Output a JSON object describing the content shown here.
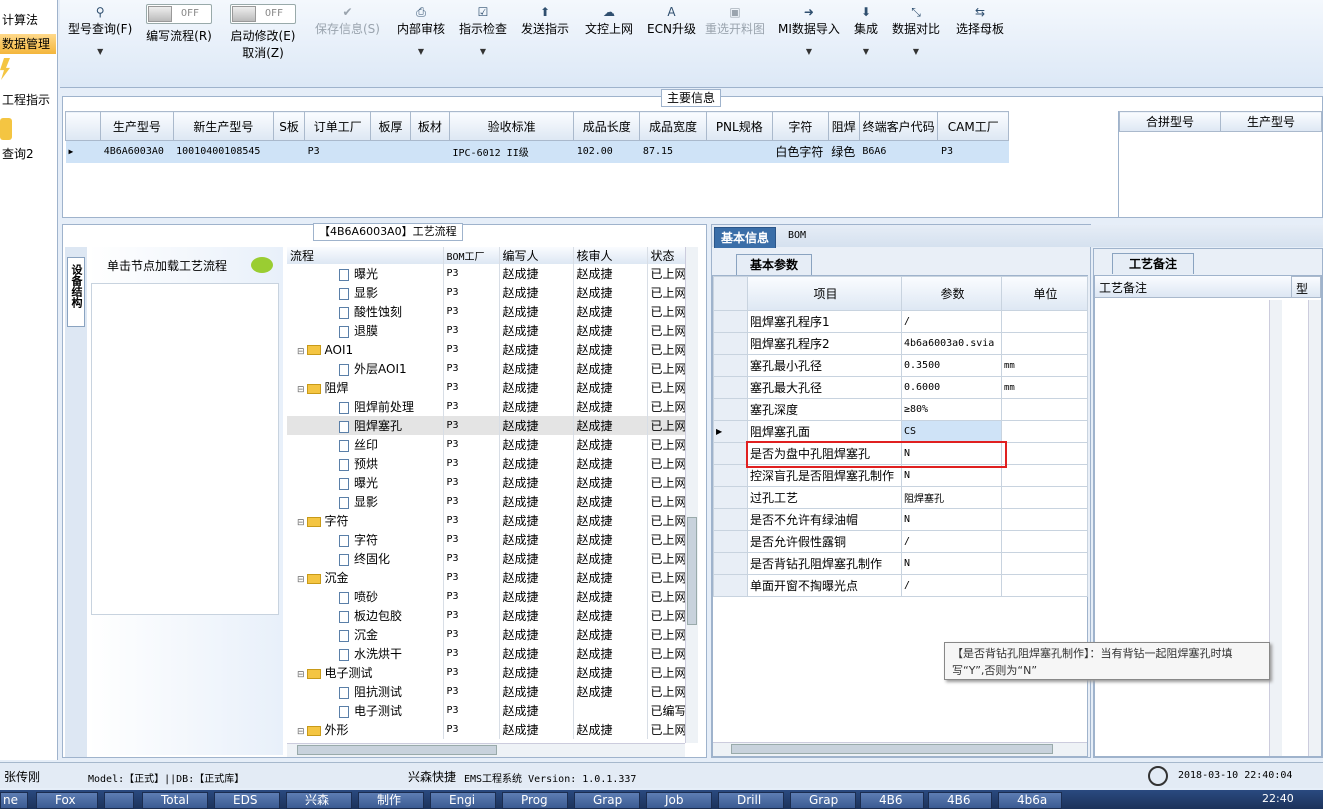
{
  "leftnav": {
    "items": [
      "计算法",
      "数据管理",
      "工程指示",
      "查询2"
    ]
  },
  "toolbar": {
    "buttons": [
      {
        "label": "型号查询(F)",
        "icon": "search-icon"
      },
      {
        "label": "编写流程(R)",
        "toggle": "OFF"
      },
      {
        "label": "启动修改(E)",
        "label2": "取消(Z)",
        "toggle": "OFF"
      },
      {
        "label": "保存信息(S)",
        "icon": "check-icon",
        "disabled": true
      },
      {
        "label": "内部审核",
        "icon": "print-icon"
      },
      {
        "label": "指示检查",
        "icon": "checkbox-icon"
      },
      {
        "label": "发送指示",
        "icon": "upload-icon"
      },
      {
        "label": "文控上网",
        "icon": "cloud-upload-icon"
      },
      {
        "label": "ECN升级",
        "icon": "font-icon"
      },
      {
        "label": "重选开料图",
        "icon": "image-icon",
        "disabled": true
      },
      {
        "label": "MI数据导入",
        "icon": "sign-in-icon"
      },
      {
        "label": "集成",
        "icon": "download-icon"
      },
      {
        "label": "数据对比",
        "icon": "compress-icon"
      },
      {
        "label": "选择母板",
        "icon": "shuffle-icon"
      }
    ]
  },
  "maininfo": {
    "title": "主要信息",
    "columns": [
      "生产型号",
      "新生产型号",
      "S板",
      "订单工厂",
      "板厚",
      "板材",
      "验收标准",
      "成品长度",
      "成品宽度",
      "PNL规格",
      "字符",
      "阻焊",
      "终端客户代码",
      "CAM工厂"
    ],
    "row": [
      "4B6A6003A0",
      "10010400108545",
      "",
      "P3",
      "",
      "",
      "IPC-6012 II级",
      "102.00",
      "87.15",
      "",
      "白色字符",
      "绿色",
      "B6A6",
      "P3"
    ],
    "merge_columns": [
      "合拼型号",
      "生产型号"
    ]
  },
  "flow": {
    "title": "【4B6A6003A0】工艺流程",
    "vtab": "设备结构",
    "hint": "单击节点加载工艺流程",
    "columns": [
      "流程",
      "BOM工厂",
      "编写人",
      "核审人",
      "状态"
    ],
    "rows": [
      {
        "name": "曝光",
        "level": 2,
        "bom": "P3",
        "writer": "赵成捷",
        "reviewer": "赵成捷",
        "status": "已上网"
      },
      {
        "name": "显影",
        "level": 2,
        "bom": "P3",
        "writer": "赵成捷",
        "reviewer": "赵成捷",
        "status": "已上网"
      },
      {
        "name": "酸性蚀刻",
        "level": 2,
        "bom": "P3",
        "writer": "赵成捷",
        "reviewer": "赵成捷",
        "status": "已上网"
      },
      {
        "name": "退膜",
        "level": 2,
        "bom": "P3",
        "writer": "赵成捷",
        "reviewer": "赵成捷",
        "status": "已上网"
      },
      {
        "name": "AOI1",
        "level": 1,
        "bom": "P3",
        "writer": "赵成捷",
        "reviewer": "赵成捷",
        "status": "已上网"
      },
      {
        "name": "外层AOI1",
        "level": 2,
        "bom": "P3",
        "writer": "赵成捷",
        "reviewer": "赵成捷",
        "status": "已上网"
      },
      {
        "name": "阻焊",
        "level": 1,
        "bom": "P3",
        "writer": "赵成捷",
        "reviewer": "赵成捷",
        "status": "已上网"
      },
      {
        "name": "阻焊前处理",
        "level": 2,
        "bom": "P3",
        "writer": "赵成捷",
        "reviewer": "赵成捷",
        "status": "已上网"
      },
      {
        "name": "阻焊塞孔",
        "level": 2,
        "bom": "P3",
        "writer": "赵成捷",
        "reviewer": "赵成捷",
        "status": "已上网",
        "selected": true
      },
      {
        "name": "丝印",
        "level": 2,
        "bom": "P3",
        "writer": "赵成捷",
        "reviewer": "赵成捷",
        "status": "已上网"
      },
      {
        "name": "预烘",
        "level": 2,
        "bom": "P3",
        "writer": "赵成捷",
        "reviewer": "赵成捷",
        "status": "已上网"
      },
      {
        "name": "曝光",
        "level": 2,
        "bom": "P3",
        "writer": "赵成捷",
        "reviewer": "赵成捷",
        "status": "已上网"
      },
      {
        "name": "显影",
        "level": 2,
        "bom": "P3",
        "writer": "赵成捷",
        "reviewer": "赵成捷",
        "status": "已上网"
      },
      {
        "name": "字符",
        "level": 1,
        "bom": "P3",
        "writer": "赵成捷",
        "reviewer": "赵成捷",
        "status": "已上网"
      },
      {
        "name": "字符",
        "level": 2,
        "bom": "P3",
        "writer": "赵成捷",
        "reviewer": "赵成捷",
        "status": "已上网"
      },
      {
        "name": "终固化",
        "level": 2,
        "bom": "P3",
        "writer": "赵成捷",
        "reviewer": "赵成捷",
        "status": "已上网"
      },
      {
        "name": "沉金",
        "level": 1,
        "bom": "P3",
        "writer": "赵成捷",
        "reviewer": "赵成捷",
        "status": "已上网"
      },
      {
        "name": "喷砂",
        "level": 2,
        "bom": "P3",
        "writer": "赵成捷",
        "reviewer": "赵成捷",
        "status": "已上网"
      },
      {
        "name": "板边包胶",
        "level": 2,
        "bom": "P3",
        "writer": "赵成捷",
        "reviewer": "赵成捷",
        "status": "已上网"
      },
      {
        "name": "沉金",
        "level": 2,
        "bom": "P3",
        "writer": "赵成捷",
        "reviewer": "赵成捷",
        "status": "已上网"
      },
      {
        "name": "水洗烘干",
        "level": 2,
        "bom": "P3",
        "writer": "赵成捷",
        "reviewer": "赵成捷",
        "status": "已上网"
      },
      {
        "name": "电子测试",
        "level": 1,
        "bom": "P3",
        "writer": "赵成捷",
        "reviewer": "赵成捷",
        "status": "已上网"
      },
      {
        "name": "阻抗测试",
        "level": 2,
        "bom": "P3",
        "writer": "赵成捷",
        "reviewer": "赵成捷",
        "status": "已上网"
      },
      {
        "name": "电子测试",
        "level": 2,
        "bom": "P3",
        "writer": "赵成捷",
        "reviewer": "",
        "status": "已编写"
      },
      {
        "name": "外形",
        "level": 1,
        "bom": "P3",
        "writer": "赵成捷",
        "reviewer": "赵成捷",
        "status": "已上网"
      }
    ]
  },
  "basic": {
    "tabs": [
      "基本信息",
      "BOM"
    ],
    "subtab": "基本参数",
    "columns": [
      "项目",
      "参数",
      "单位"
    ],
    "rows": [
      {
        "item": "阻焊塞孔程序1",
        "value": "/",
        "unit": ""
      },
      {
        "item": "阻焊塞孔程序2",
        "value": "4b6a6003a0.svia",
        "unit": ""
      },
      {
        "item": "塞孔最小孔径",
        "value": "0.3500",
        "unit": "mm"
      },
      {
        "item": "塞孔最大孔径",
        "value": "0.6000",
        "unit": "mm"
      },
      {
        "item": "塞孔深度",
        "value": "≥80%",
        "unit": ""
      },
      {
        "item": "阻焊塞孔面",
        "value": "CS",
        "unit": "",
        "current": true
      },
      {
        "item": "是否为盘中孔阻焊塞孔",
        "value": "N",
        "unit": "",
        "highlight": true
      },
      {
        "item": "控深盲孔是否阻焊塞孔制作",
        "value": "N",
        "unit": ""
      },
      {
        "item": "过孔工艺",
        "value": "阻焊塞孔",
        "unit": ""
      },
      {
        "item": "是否不允许有绿油帽",
        "value": "N",
        "unit": ""
      },
      {
        "item": "是否允许假性露铜",
        "value": "/",
        "unit": ""
      },
      {
        "item": "是否背钻孔阻焊塞孔制作",
        "value": "N",
        "unit": ""
      },
      {
        "item": "单面开窗不掏曝光点",
        "value": "/",
        "unit": ""
      }
    ],
    "tooltip": "【是否背钻孔阻焊塞孔制作】：当有背钻一起阻焊塞孔时填写“Y”,否则为“N”"
  },
  "notes": {
    "tab": "工艺备注",
    "columns": [
      "工艺备注",
      "型"
    ]
  },
  "status": {
    "user": "张传刚",
    "model": "Model:【正式】||DB:【正式库】",
    "company": "兴森快捷",
    "system": "EMS工程系统 Version: 1.0.1.337",
    "datetime": "2018-03-10 22:40:04"
  },
  "taskbar": {
    "items": [
      "Fox",
      "",
      "Total",
      "EDS",
      "兴森",
      "制作",
      "Engi",
      "Prog",
      "Grap",
      "Job",
      "Drill",
      "Grap",
      "4B6",
      "4B6",
      "4b6a"
    ],
    "clock": "22:40"
  },
  "colors": {
    "accent": "#f4b63c",
    "selection": "#cfe3f7",
    "highlight_box": "#e02020"
  }
}
